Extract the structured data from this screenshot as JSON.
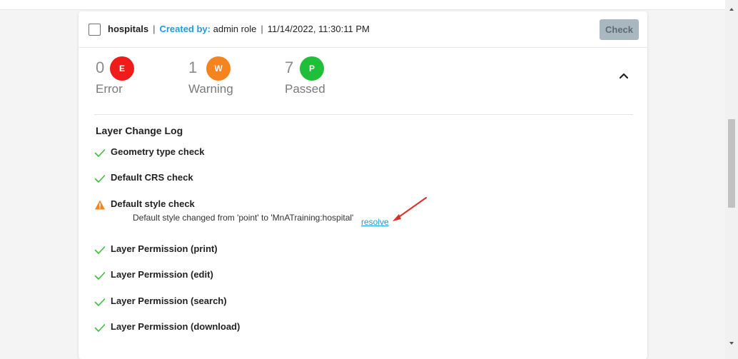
{
  "header": {
    "layer_name": "hospitals",
    "separator": "|",
    "created_by_label": "Created by:",
    "created_by_value": "admin role",
    "timestamp": "11/14/2022, 11:30:11 PM",
    "check_button": "Check"
  },
  "summary": {
    "error": {
      "count": "0",
      "badge": "E",
      "label": "Error",
      "color": "#f01c1c"
    },
    "warning": {
      "count": "1",
      "badge": "W",
      "label": "Warning",
      "color": "#f5841f"
    },
    "passed": {
      "count": "7",
      "badge": "P",
      "label": "Passed",
      "color": "#1fbf3a"
    }
  },
  "section": {
    "title": "Layer Change Log",
    "items": [
      {
        "label": "Geometry type check",
        "status": "passed"
      },
      {
        "label": "Default CRS check",
        "status": "passed"
      },
      {
        "label": "Default style check",
        "status": "warning",
        "detail": "Default style changed from 'point' to 'MnATraining:hospital'",
        "action": "resolve"
      },
      {
        "label": "Layer Permission (print)",
        "status": "passed"
      },
      {
        "label": "Layer Permission (edit)",
        "status": "passed"
      },
      {
        "label": "Layer Permission (search)",
        "status": "passed"
      },
      {
        "label": "Layer Permission (download)",
        "status": "passed"
      }
    ]
  },
  "colors": {
    "accent": "#1e9be0",
    "check_green": "#3bbf3b",
    "warning_orange": "#f5841f",
    "annotation_red": "#d9302c"
  },
  "icons": {
    "passed": "checkmark-icon",
    "warning": "warning-triangle-icon",
    "collapse": "chevron-up-icon"
  }
}
